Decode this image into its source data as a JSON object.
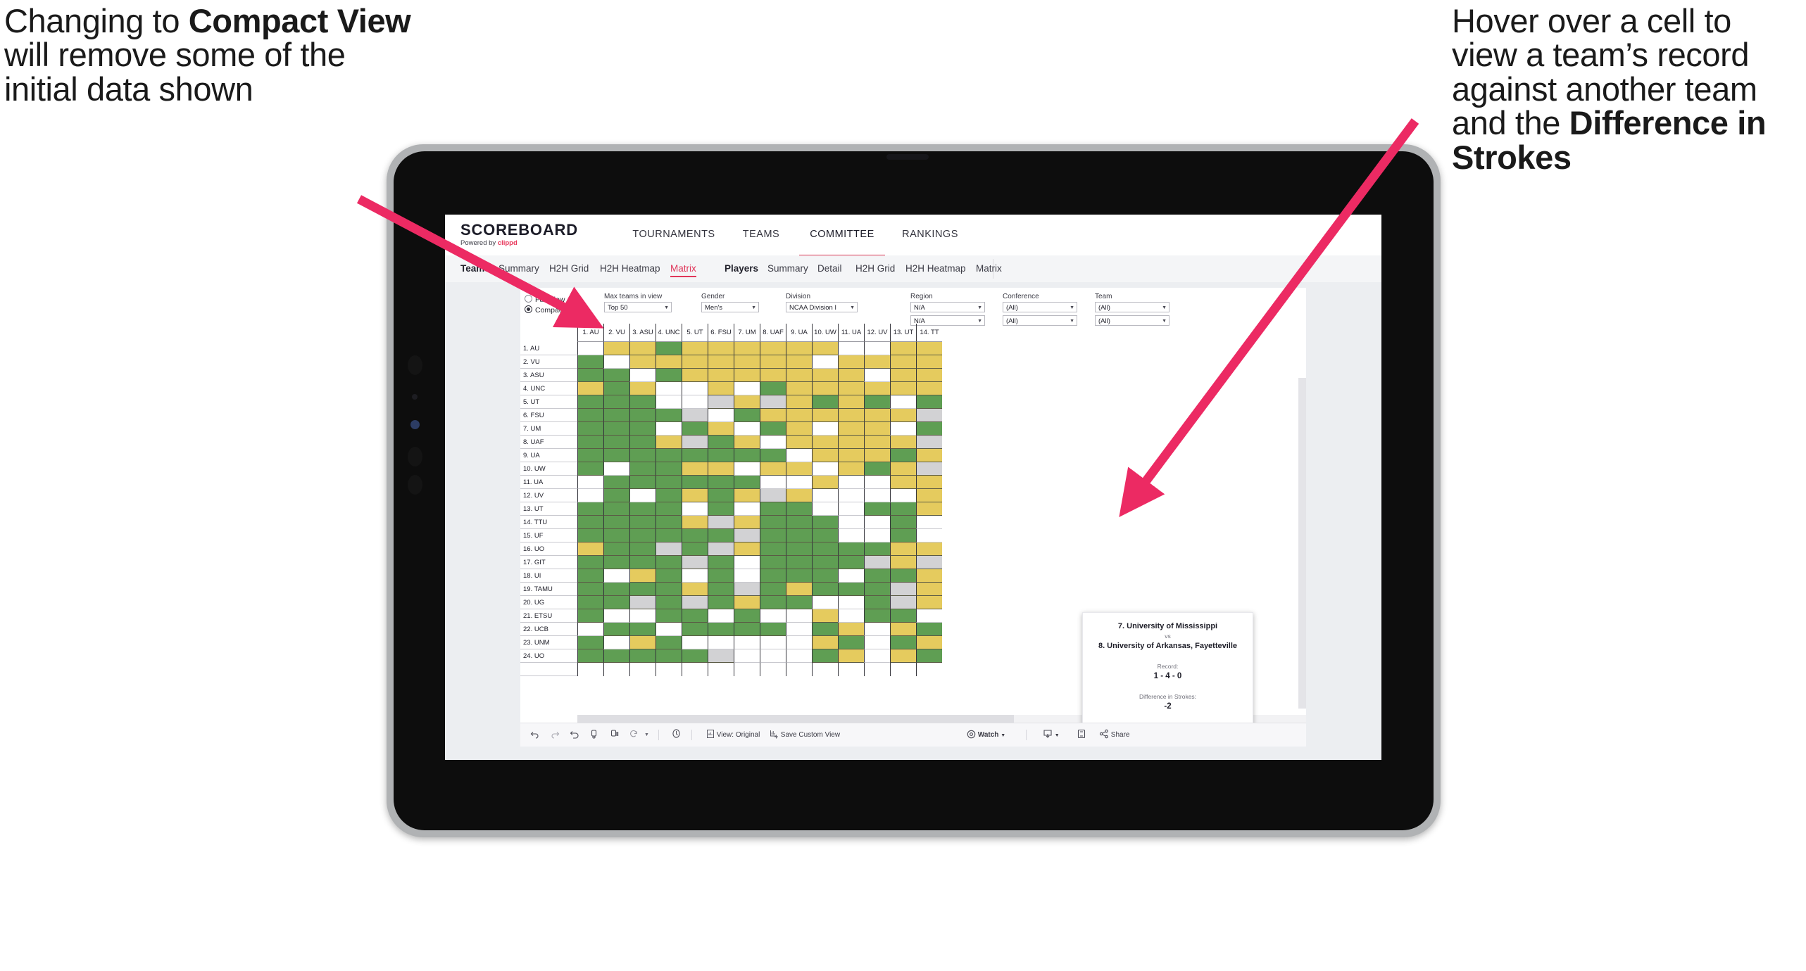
{
  "annotations": {
    "left": {
      "line1": "Changing to",
      "bold": "Compact View",
      "line2": " will remove some of the initial data shown"
    },
    "right": {
      "line1": "Hover over a cell to view a team’s record against another team and the ",
      "bold": "Difference in Strokes"
    },
    "arrow_color": "#ec2a63"
  },
  "topnav": {
    "logo_word": "SCOREBOARD",
    "logo_sub_prefix": "Powered by ",
    "logo_sub_brand": "clippd",
    "items": [
      {
        "label": "TOURNAMENTS",
        "active": false
      },
      {
        "label": "TEAMS",
        "active": false
      },
      {
        "label": "COMMITTEE",
        "active": true
      },
      {
        "label": "RANKINGS",
        "active": false
      }
    ]
  },
  "subnav": {
    "teams_label": "Teams",
    "teams_items": [
      {
        "label": "Summary",
        "active": false
      },
      {
        "label": "H2H Grid",
        "active": false
      },
      {
        "label": "H2H Heatmap",
        "active": false
      },
      {
        "label": "Matrix",
        "active": true
      }
    ],
    "players_label": "Players",
    "players_items": [
      {
        "label": "Summary",
        "active": false
      },
      {
        "label": "Detail",
        "active": false
      },
      {
        "label": "H2H Grid",
        "active": false
      },
      {
        "label": "H2H Heatmap",
        "active": false
      },
      {
        "label": "Matrix",
        "active": false
      }
    ]
  },
  "filters": {
    "view_mode": {
      "full_label": "Full View",
      "compact_label": "Compact View",
      "selected": "Compact View"
    },
    "controls": [
      {
        "label": "Max teams in view",
        "value": "Top 50"
      },
      {
        "label": "Gender",
        "value": "Men's"
      },
      {
        "label": "Division",
        "value": "NCAA Division I"
      },
      {
        "label": "Region",
        "value": "N/A",
        "value2": "N/A"
      },
      {
        "label": "Conference",
        "value": "(All)",
        "value2": "(All)"
      },
      {
        "label": "Team",
        "value": "(All)",
        "value2": "(All)"
      }
    ]
  },
  "matrix": {
    "columns": [
      "1. AU",
      "2. VU",
      "3. ASU",
      "4. UNC",
      "5. UT",
      "6. FSU",
      "7. UM",
      "8. UAF",
      "9. UA",
      "10. UW",
      "11. UA",
      "12. UV",
      "13. UT",
      "14. TT"
    ],
    "rows": [
      "1. AU",
      "2. VU",
      "3. ASU",
      "4. UNC",
      "5. UT",
      "6. FSU",
      "7. UM",
      "8. UAF",
      "9. UA",
      "10. UW",
      "11. UA",
      "12. UV",
      "13. UT",
      "14. TTU",
      "15. UF",
      "16. UO",
      "17. GIT",
      "18. UI",
      "19. TAMU",
      "20. UG",
      "21. ETSU",
      "22. UCB",
      "23. UNM",
      "24. UO"
    ],
    "legend": {
      "win": "#5f9e53",
      "loss": "#e5cb5e",
      "tie": "#d2d2d4",
      "none": "#ffffff"
    },
    "cells": [
      [
        "w",
        "y",
        "y",
        "g",
        "y",
        "y",
        "y",
        "y",
        "y",
        "y",
        "w",
        "w",
        "y",
        "y"
      ],
      [
        "g",
        "w",
        "y",
        "y",
        "y",
        "y",
        "y",
        "y",
        "y",
        "w",
        "y",
        "y",
        "y",
        "y"
      ],
      [
        "g",
        "g",
        "w",
        "g",
        "y",
        "y",
        "y",
        "y",
        "y",
        "y",
        "y",
        "w",
        "y",
        "y"
      ],
      [
        "y",
        "g",
        "y",
        "w",
        "w",
        "y",
        "w",
        "g",
        "y",
        "y",
        "y",
        "y",
        "y",
        "y"
      ],
      [
        "g",
        "g",
        "g",
        "w",
        "w",
        "a",
        "y",
        "a",
        "y",
        "g",
        "y",
        "g",
        "w",
        "g"
      ],
      [
        "g",
        "g",
        "g",
        "g",
        "a",
        "w",
        "g",
        "y",
        "y",
        "y",
        "y",
        "y",
        "y",
        "a"
      ],
      [
        "g",
        "g",
        "g",
        "w",
        "g",
        "y",
        "w",
        "g",
        "y",
        "w",
        "y",
        "y",
        "w",
        "g"
      ],
      [
        "g",
        "g",
        "g",
        "y",
        "a",
        "g",
        "y",
        "w",
        "y",
        "y",
        "y",
        "y",
        "y",
        "a"
      ],
      [
        "g",
        "g",
        "g",
        "g",
        "g",
        "g",
        "g",
        "g",
        "w",
        "y",
        "y",
        "y",
        "g",
        "y"
      ],
      [
        "g",
        "w",
        "g",
        "g",
        "y",
        "y",
        "w",
        "y",
        "y",
        "w",
        "y",
        "g",
        "y",
        "a"
      ],
      [
        "w",
        "g",
        "g",
        "g",
        "g",
        "g",
        "g",
        "w",
        "w",
        "y",
        "w",
        "w",
        "y",
        "y"
      ],
      [
        "w",
        "g",
        "w",
        "g",
        "y",
        "g",
        "y",
        "a",
        "y",
        "w",
        "w",
        "w",
        "w",
        "y"
      ],
      [
        "g",
        "g",
        "g",
        "g",
        "w",
        "g",
        "w",
        "g",
        "g",
        "w",
        "w",
        "g",
        "g",
        "y"
      ],
      [
        "g",
        "g",
        "g",
        "g",
        "y",
        "a",
        "y",
        "g",
        "g",
        "g",
        "w",
        "w",
        "g",
        "w"
      ],
      [
        "g",
        "g",
        "g",
        "g",
        "g",
        "g",
        "a",
        "g",
        "g",
        "g",
        "w",
        "w",
        "g",
        "w"
      ],
      [
        "y",
        "g",
        "g",
        "a",
        "g",
        "a",
        "y",
        "g",
        "g",
        "g",
        "g",
        "g",
        "y",
        "y"
      ],
      [
        "g",
        "g",
        "g",
        "g",
        "a",
        "g",
        "w",
        "g",
        "g",
        "g",
        "g",
        "a",
        "y",
        "a"
      ],
      [
        "g",
        "w",
        "y",
        "g",
        "w",
        "g",
        "w",
        "g",
        "g",
        "g",
        "w",
        "g",
        "g",
        "y"
      ],
      [
        "g",
        "g",
        "g",
        "g",
        "y",
        "g",
        "a",
        "g",
        "y",
        "g",
        "g",
        "g",
        "a",
        "y"
      ],
      [
        "g",
        "g",
        "a",
        "g",
        "a",
        "g",
        "y",
        "g",
        "g",
        "w",
        "w",
        "g",
        "a",
        "y"
      ],
      [
        "g",
        "w",
        "w",
        "g",
        "g",
        "w",
        "g",
        "w",
        "w",
        "y",
        "w",
        "g",
        "g",
        "w"
      ],
      [
        "w",
        "g",
        "g",
        "w",
        "g",
        "g",
        "g",
        "g",
        "w",
        "g",
        "y",
        "w",
        "y",
        "g"
      ],
      [
        "g",
        "w",
        "y",
        "g",
        "w",
        "w",
        "w",
        "w",
        "w",
        "y",
        "g",
        "w",
        "g",
        "y"
      ],
      [
        "g",
        "g",
        "g",
        "g",
        "g",
        "a",
        "w",
        "w",
        "w",
        "g",
        "y",
        "w",
        "y",
        "g"
      ]
    ]
  },
  "tooltip": {
    "team_a": "7. University of Mississippi",
    "vs": "vs",
    "team_b": "8. University of Arkansas, Fayetteville",
    "record_label": "Record:",
    "record_value": "1 - 4 - 0",
    "diff_label": "Difference in Strokes:",
    "diff_value": "-2"
  },
  "toolbar": {
    "view_label": "View: Original",
    "save_label": "Save Custom View",
    "watch_label": "Watch",
    "share_label": "Share"
  }
}
